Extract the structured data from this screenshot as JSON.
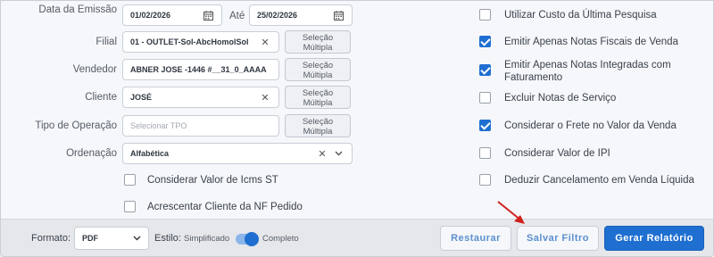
{
  "filters": {
    "data_emissao_label": "Data da Emissão",
    "data_inicio": "01/02/2026",
    "ate_label": "Até",
    "data_fim": "25/02/2026",
    "filial_label": "Filial",
    "filial_value": "01 - OUTLET-Sol-AbcHomolSol",
    "vendedor_label": "Vendedor",
    "vendedor_value": "ABNER JOSE -1446 #__31_0_AAAA",
    "cliente_label": "Cliente",
    "cliente_value": "JOSÉ",
    "tipo_operacao_label": "Tipo de Operação",
    "tipo_operacao_placeholder": "Selecionar TPO",
    "ordenacao_label": "Ordenação",
    "ordenacao_value": "Alfabética",
    "selecao_multipla_line1": "Seleção",
    "selecao_multipla_line2": "Múltipla"
  },
  "left_options": [
    {
      "label": "Considerar Valor de Icms ST",
      "checked": false
    },
    {
      "label": "Acrescentar Cliente da NF Pedido",
      "checked": false
    }
  ],
  "right_options": [
    {
      "label": "Utilizar Custo da Última Pesquisa",
      "checked": false
    },
    {
      "label": "Emitir Apenas Notas Fiscais de Venda",
      "checked": true
    },
    {
      "label": "Emitir Apenas Notas Integradas com",
      "label2": "Faturamento",
      "checked": true
    },
    {
      "label": "Excluir Notas de Serviço",
      "checked": false
    },
    {
      "label": "Considerar o Frete no Valor da Venda",
      "checked": true
    },
    {
      "label": "Considerar Valor de IPI",
      "checked": false
    },
    {
      "label": "Deduzir Cancelamento em Venda Líquida",
      "checked": false
    }
  ],
  "footer": {
    "formato_label": "Formato:",
    "formato_value": "PDF",
    "estilo_label": "Estilo:",
    "simplificado_label": "Simplificado",
    "completo_label": "Completo",
    "estilo_completo": true,
    "restaurar_label": "Restaurar",
    "salvar_label": "Salvar Filtro",
    "gerar_label": "Gerar Relatório"
  },
  "icons": {
    "calendar": "calendar-icon",
    "clear": "close-icon",
    "dropdown": "chevron-down-icon",
    "annotation": "red-arrow-icon"
  },
  "colors": {
    "accent": "#1f6fd1",
    "annotation_arrow": "#d0211c"
  }
}
